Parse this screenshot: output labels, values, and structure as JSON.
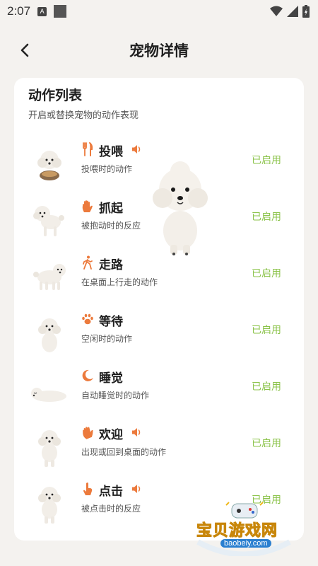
{
  "status_bar": {
    "time": "2:07",
    "notification_letter": "A"
  },
  "header": {
    "title": "宠物详情"
  },
  "section": {
    "title": "动作列表",
    "subtitle": "开启或替换宠物的动作表现"
  },
  "actions": [
    {
      "name": "投喂",
      "desc": "投喂时的动作",
      "status": "已启用",
      "icon": "fork-knife-icon",
      "has_sound": true
    },
    {
      "name": "抓起",
      "desc": "被抱动时的反应",
      "status": "已启用",
      "icon": "hand-icon",
      "has_sound": false
    },
    {
      "name": "走路",
      "desc": "在桌面上行走的动作",
      "status": "已启用",
      "icon": "walking-person-icon",
      "has_sound": false
    },
    {
      "name": "等待",
      "desc": "空闲时的动作",
      "status": "已启用",
      "icon": "paw-icon",
      "has_sound": false
    },
    {
      "name": "睡觉",
      "desc": "自动睡觉时的动作",
      "status": "已启用",
      "icon": "moon-icon",
      "has_sound": false
    },
    {
      "name": "欢迎",
      "desc": "出现或回到桌面的动作",
      "status": "已启用",
      "icon": "waving-hand-icon",
      "has_sound": true
    },
    {
      "name": "点击",
      "desc": "被点击时的反应",
      "status": "已启用",
      "icon": "tap-finger-icon",
      "has_sound": true
    }
  ],
  "watermark": {
    "text": "宝贝游戏网",
    "url": "baobeiy.com"
  },
  "colors": {
    "accent_orange": "#ec7a3c",
    "status_green": "#8bc34a",
    "background": "#f4f2ef",
    "card": "#ffffff"
  }
}
